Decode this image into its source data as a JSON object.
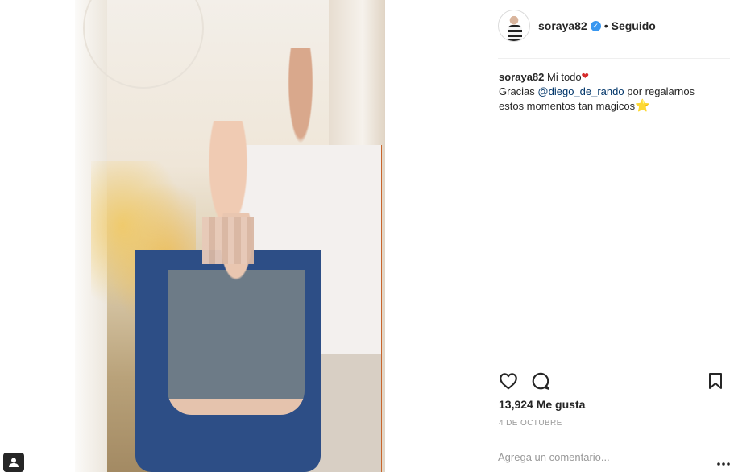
{
  "post": {
    "username": "soraya82",
    "separator": "•",
    "follow_status": "Seguido",
    "caption": {
      "username": "soraya82",
      "text_1": "Mi todo",
      "line2_before": "Gracias",
      "mention": "@diego_de_rando",
      "line2_after": "por regalarnos",
      "line3": "estos momentos tan magicos"
    },
    "likes": "13,924 Me gusta",
    "date": "4 DE OCTUBRE",
    "comment_placeholder": "Agrega un comentario..."
  },
  "icons": {
    "verified": "verified-badge-icon",
    "like": "heart-icon",
    "comment": "comment-icon",
    "save": "bookmark-icon",
    "more": "more-options-icon",
    "tagged": "user-tag-icon"
  },
  "colors": {
    "verified_blue": "#3897f0",
    "mention": "#003569",
    "muted": "#999999",
    "text": "#262626"
  }
}
